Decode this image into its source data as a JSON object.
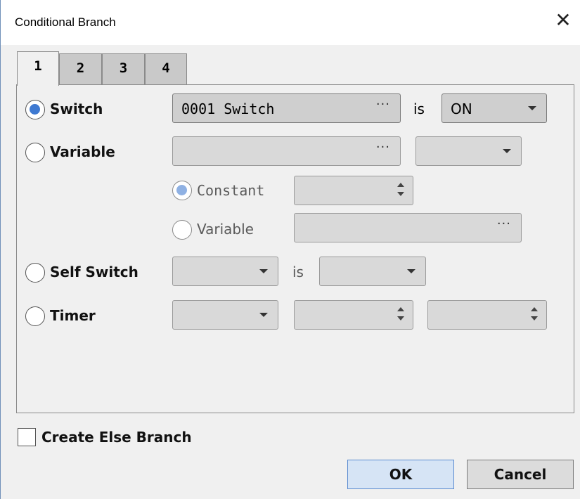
{
  "window": {
    "title": "Conditional Branch",
    "close_glyph": "✕"
  },
  "tabs": [
    {
      "label": "1",
      "active": true
    },
    {
      "label": "2",
      "active": false
    },
    {
      "label": "3",
      "active": false
    },
    {
      "label": "4",
      "active": false
    }
  ],
  "switch_row": {
    "label": "Switch",
    "value": "0001 Switch",
    "browse": "···",
    "is_label": "is",
    "state_value": "ON"
  },
  "variable_row": {
    "label": "Variable",
    "browse": "···",
    "operator_value": ""
  },
  "compare": {
    "constant_label": "Constant",
    "variable_label": "Variable",
    "variable_browse": "···"
  },
  "self_switch_row": {
    "label": "Self Switch",
    "is_label": "is"
  },
  "timer_row": {
    "label": "Timer"
  },
  "else_branch": {
    "label": "Create Else Branch",
    "checked": false
  },
  "buttons": {
    "ok": "OK",
    "cancel": "Cancel"
  },
  "colors": {
    "radio_checked": "#3e79d1",
    "ok_button": "#d6e4f5"
  }
}
